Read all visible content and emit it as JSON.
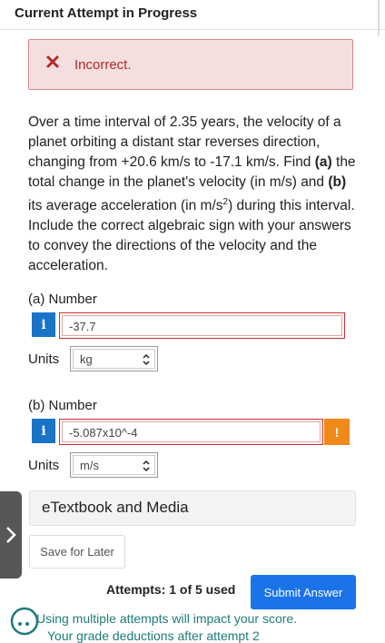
{
  "header": {
    "title": "Current Attempt in Progress"
  },
  "feedback": {
    "icon": "x-icon",
    "text": "Incorrect."
  },
  "question": {
    "text_parts": [
      "Over a time interval of 2.35 years, the velocity of a planet orbiting a distant star reverses direction, changing from +20.6 km/s to -17.1 km/s. Find ",
      "(a)",
      " the total change in the planet's velocity (in m/s) and ",
      "(b)",
      " its average acceleration (in m/s",
      "2",
      ") during this interval. Include the correct algebraic sign with your answers to convey the directions of the velocity and the acceleration."
    ]
  },
  "part_a": {
    "label": "(a) Number",
    "info_label": "i",
    "value": "-37.7",
    "units_label": "Units",
    "units_value": "kg"
  },
  "part_b": {
    "label": "(b) Number",
    "info_label": "i",
    "value": "-5.087x10^-4",
    "warn_label": "!",
    "units_label": "Units",
    "units_value": "m/s"
  },
  "resources": {
    "etextbook_label": "eTextbook and Media"
  },
  "actions": {
    "save_later_label": "Save for Later",
    "attempts_text": "Attempts: 1 of 5 used",
    "submit_label": "Submit Answer"
  },
  "footer": {
    "multi_attempts_text": "Using multiple attempts will impact your score.",
    "cut_text": "Your grade deductions after attempt 2"
  },
  "colors": {
    "accent": "#1a73e8",
    "error": "#c83232",
    "warning": "#ef8a1b",
    "info": "#1a73c7"
  }
}
